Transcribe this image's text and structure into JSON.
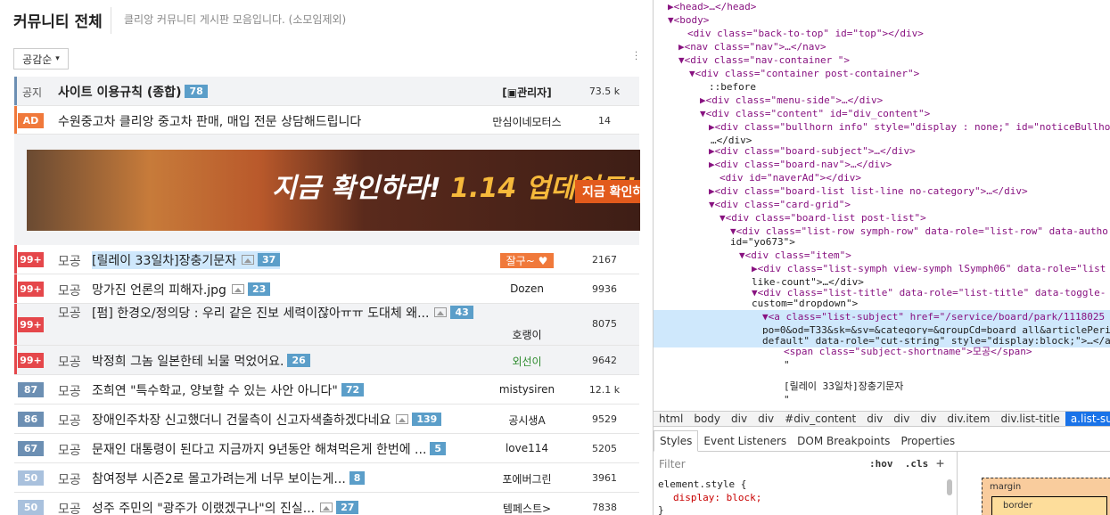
{
  "board": {
    "title": "커뮤니티 전체",
    "description": "클리앙 커뮤니티 게시판 모음입니다. (소모임제외)",
    "sort_label": "공감순"
  },
  "notice": {
    "category": "공지",
    "title": "사이트 이용규칙 (종합)",
    "count": "78",
    "author": "[▣관리자]",
    "hits": "73.5 k"
  },
  "ad": {
    "badge": "AD",
    "title": "수원중고차 클리앙 중고차 판매, 매입 전문 상담해드립니다",
    "author": "만심이네모터스",
    "hits": "14"
  },
  "banner": {
    "text_main": "지금 확인하라! ",
    "text_accent": "1.14 업데이트!",
    "chip": "지금 확인하"
  },
  "posts": [
    {
      "rank": "99+",
      "category": "모공",
      "title": "[릴레이 33일차]장충기문자",
      "has_image": true,
      "count": "37",
      "author": "잘구~ ♥",
      "hits": "2167"
    },
    {
      "rank": "99+",
      "category": "모공",
      "title": "망가진 언론의 피해자.jpg",
      "has_image": true,
      "count": "23",
      "author": "Dozen",
      "hits": "9936"
    },
    {
      "rank": "99+",
      "category": "모공",
      "title": "[펌] 한경오/정의당 : 우리 같은 진보 세력이잖아ㅠㅠ 도대체 왜...",
      "has_image": true,
      "count": "43",
      "author": "호랭이",
      "hits": "8075"
    },
    {
      "rank": "99+",
      "category": "모공",
      "title": "박정희 그놈 일본한테 뇌물 먹었어요.",
      "has_image": false,
      "count": "26",
      "author": "외선이",
      "hits": "9642"
    },
    {
      "rank": "87",
      "category": "모공",
      "title": "조희연 \"특수학교, 양보할 수 있는 사안 아니다\"",
      "has_image": false,
      "count": "72",
      "author": "mistysiren",
      "hits": "12.1 k"
    },
    {
      "rank": "86",
      "category": "모공",
      "title": "장애인주차장 신고했더니 건물측이 신고자색출하겠다네요",
      "has_image": true,
      "count": "139",
      "author": "공시생A",
      "hits": "9529"
    },
    {
      "rank": "67",
      "category": "모공",
      "title": "문재인 대통령이 된다고 지금까지 9년동안 해쳐먹은게 한번에 ...",
      "has_image": false,
      "count": "5",
      "author": "love114",
      "hits": "5205"
    },
    {
      "rank": "50",
      "category": "모공",
      "title": "참여정부 시즌2로 몰고가려는게 너무 보이는게...",
      "has_image": false,
      "count": "8",
      "author": "포에버그린",
      "hits": "3961"
    },
    {
      "rank": "50",
      "category": "모공",
      "title": "성주 주민의 \"광주가 이랬겠구나\"의 진실...",
      "has_image": true,
      "count": "27",
      "author": "템페스트>",
      "hits": "7838"
    }
  ],
  "devtools": {
    "dom_lines": [
      "▶<head>…</head>",
      "▼<body>",
      "<div class=\"back-to-top\" id=\"top\"></div>",
      "▶<nav class=\"nav\">…</nav>",
      "▼<div class=\"nav-container \">",
      "▼<div class=\"container post-container\">",
      "::before",
      "▶<div class=\"menu-side\">…</div>",
      "▼<div class=\"content\" id=\"div_content\">",
      "▶<div class=\"bullhorn info\" style=\"display : none;\" id=\"noticeBullho",
      "…</div>",
      "▶<div class=\"board-subject\">…</div>",
      "▶<div class=\"board-nav\">…</div>",
      "<div id=\"naverAd\"></div>",
      "▶<div class=\"board-list list-line no-category\">…</div>",
      "▼<div class=\"card-grid\">",
      "▼<div class=\"board-list post-list\">",
      "▼<div class=\"list-row symph-row\" data-role=\"list-row\" data-autho",
      "id=\"yo673\">",
      "▼<div class=\"item\">",
      "▶<div class=\"list-symph view-symph lSymph06\" data-role=\"list",
      "like-count\">…</div>",
      "▼<div class=\"list-title\" data-role=\"list-title\" data-toggle-",
      "custom=\"dropdown\">",
      "▼<a class=\"list-subject\" href=\"/service/board/park/1118025",
      "po=0&od=T33&sk=&sv=&category=&groupCd=board_all&articlePeri",
      "default\" data-role=\"cut-string\" style=\"display:block;\">…</a",
      "<span class=\"subject-shortname\">모공</span>",
      "\"",
      "[릴레이 33일차]장충기문자",
      "\""
    ],
    "breadcrumbs": [
      "html",
      "body",
      "div",
      "div",
      "#div_content",
      "div",
      "div",
      "div",
      "div.item",
      "div.list-title",
      "a.list-subject"
    ],
    "panel_tabs": [
      "Styles",
      "Event Listeners",
      "DOM Breakpoints",
      "Properties"
    ],
    "filter_placeholder": "Filter",
    "hov": ":hov",
    "cls": ".cls",
    "plus": "+",
    "style_lines": [
      "element.style {",
      "display: block;",
      "}"
    ],
    "box_margin": "margin",
    "box_border": "border"
  },
  "colors": {
    "rank_hot": "#e5474b",
    "rank_mid": "#6c8fb3",
    "rank_low": "#a9c1dd",
    "count_badge": "#5b9ec9",
    "ad_badge": "#f0793b",
    "selected_row": "#cfe8fc"
  }
}
